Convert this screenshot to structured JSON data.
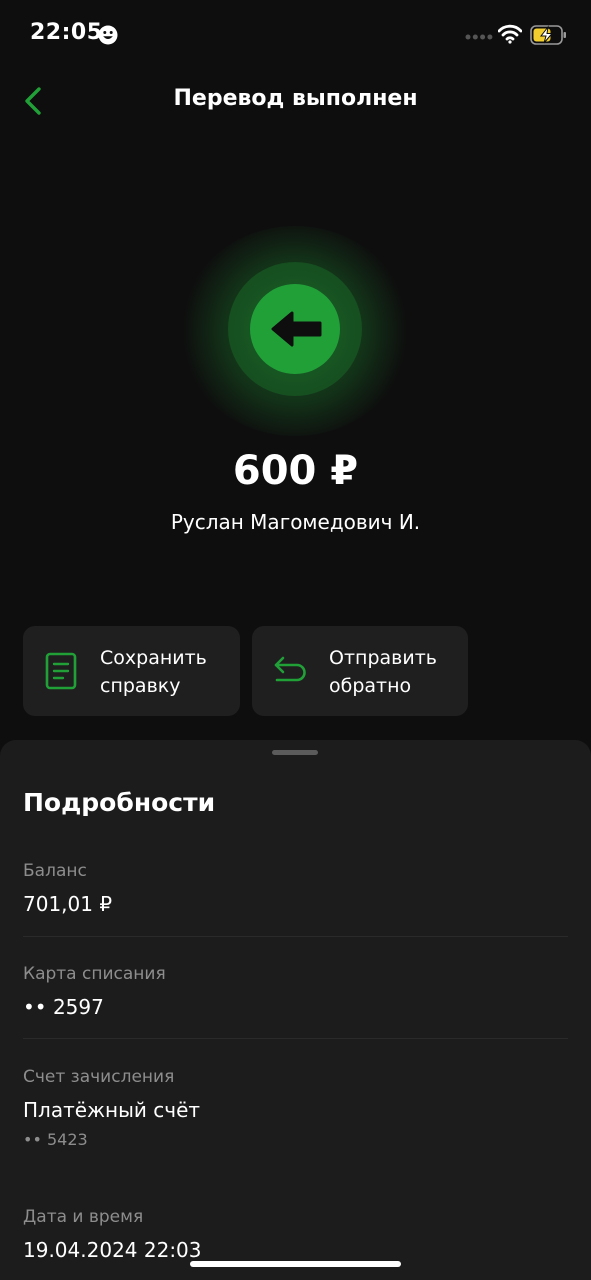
{
  "status_bar": {
    "time": "22:05"
  },
  "header": {
    "title": "Перевод выполнен"
  },
  "transfer": {
    "amount": "600 ₽",
    "recipient": "Руслан Магомедович И."
  },
  "actions": {
    "save_label": "Сохранить справку",
    "return_label": "Отправить обратно"
  },
  "details": {
    "title": "Подробности",
    "balance_label": "Баланс",
    "balance_value": "701,01 ₽",
    "card_label": "Карта списания",
    "card_value": "•• 2597",
    "account_label": "Счет зачисления",
    "account_value": "Платёжный счёт",
    "account_number": "•• 5423",
    "datetime_label": "Дата и время",
    "datetime_value": "19.04.2024 22:03"
  },
  "colors": {
    "accent": "#21a038",
    "background": "#0e0e0e",
    "card": "#1f1f1f",
    "sheet": "#1c1c1c",
    "muted_text": "#8d8d8d"
  },
  "icons": [
    "smiley-icon",
    "signal-dots-icon",
    "wifi-icon",
    "battery-charging-icon",
    "back-arrow-icon",
    "transfer-arrow-icon",
    "document-icon",
    "return-arrow-icon"
  ]
}
